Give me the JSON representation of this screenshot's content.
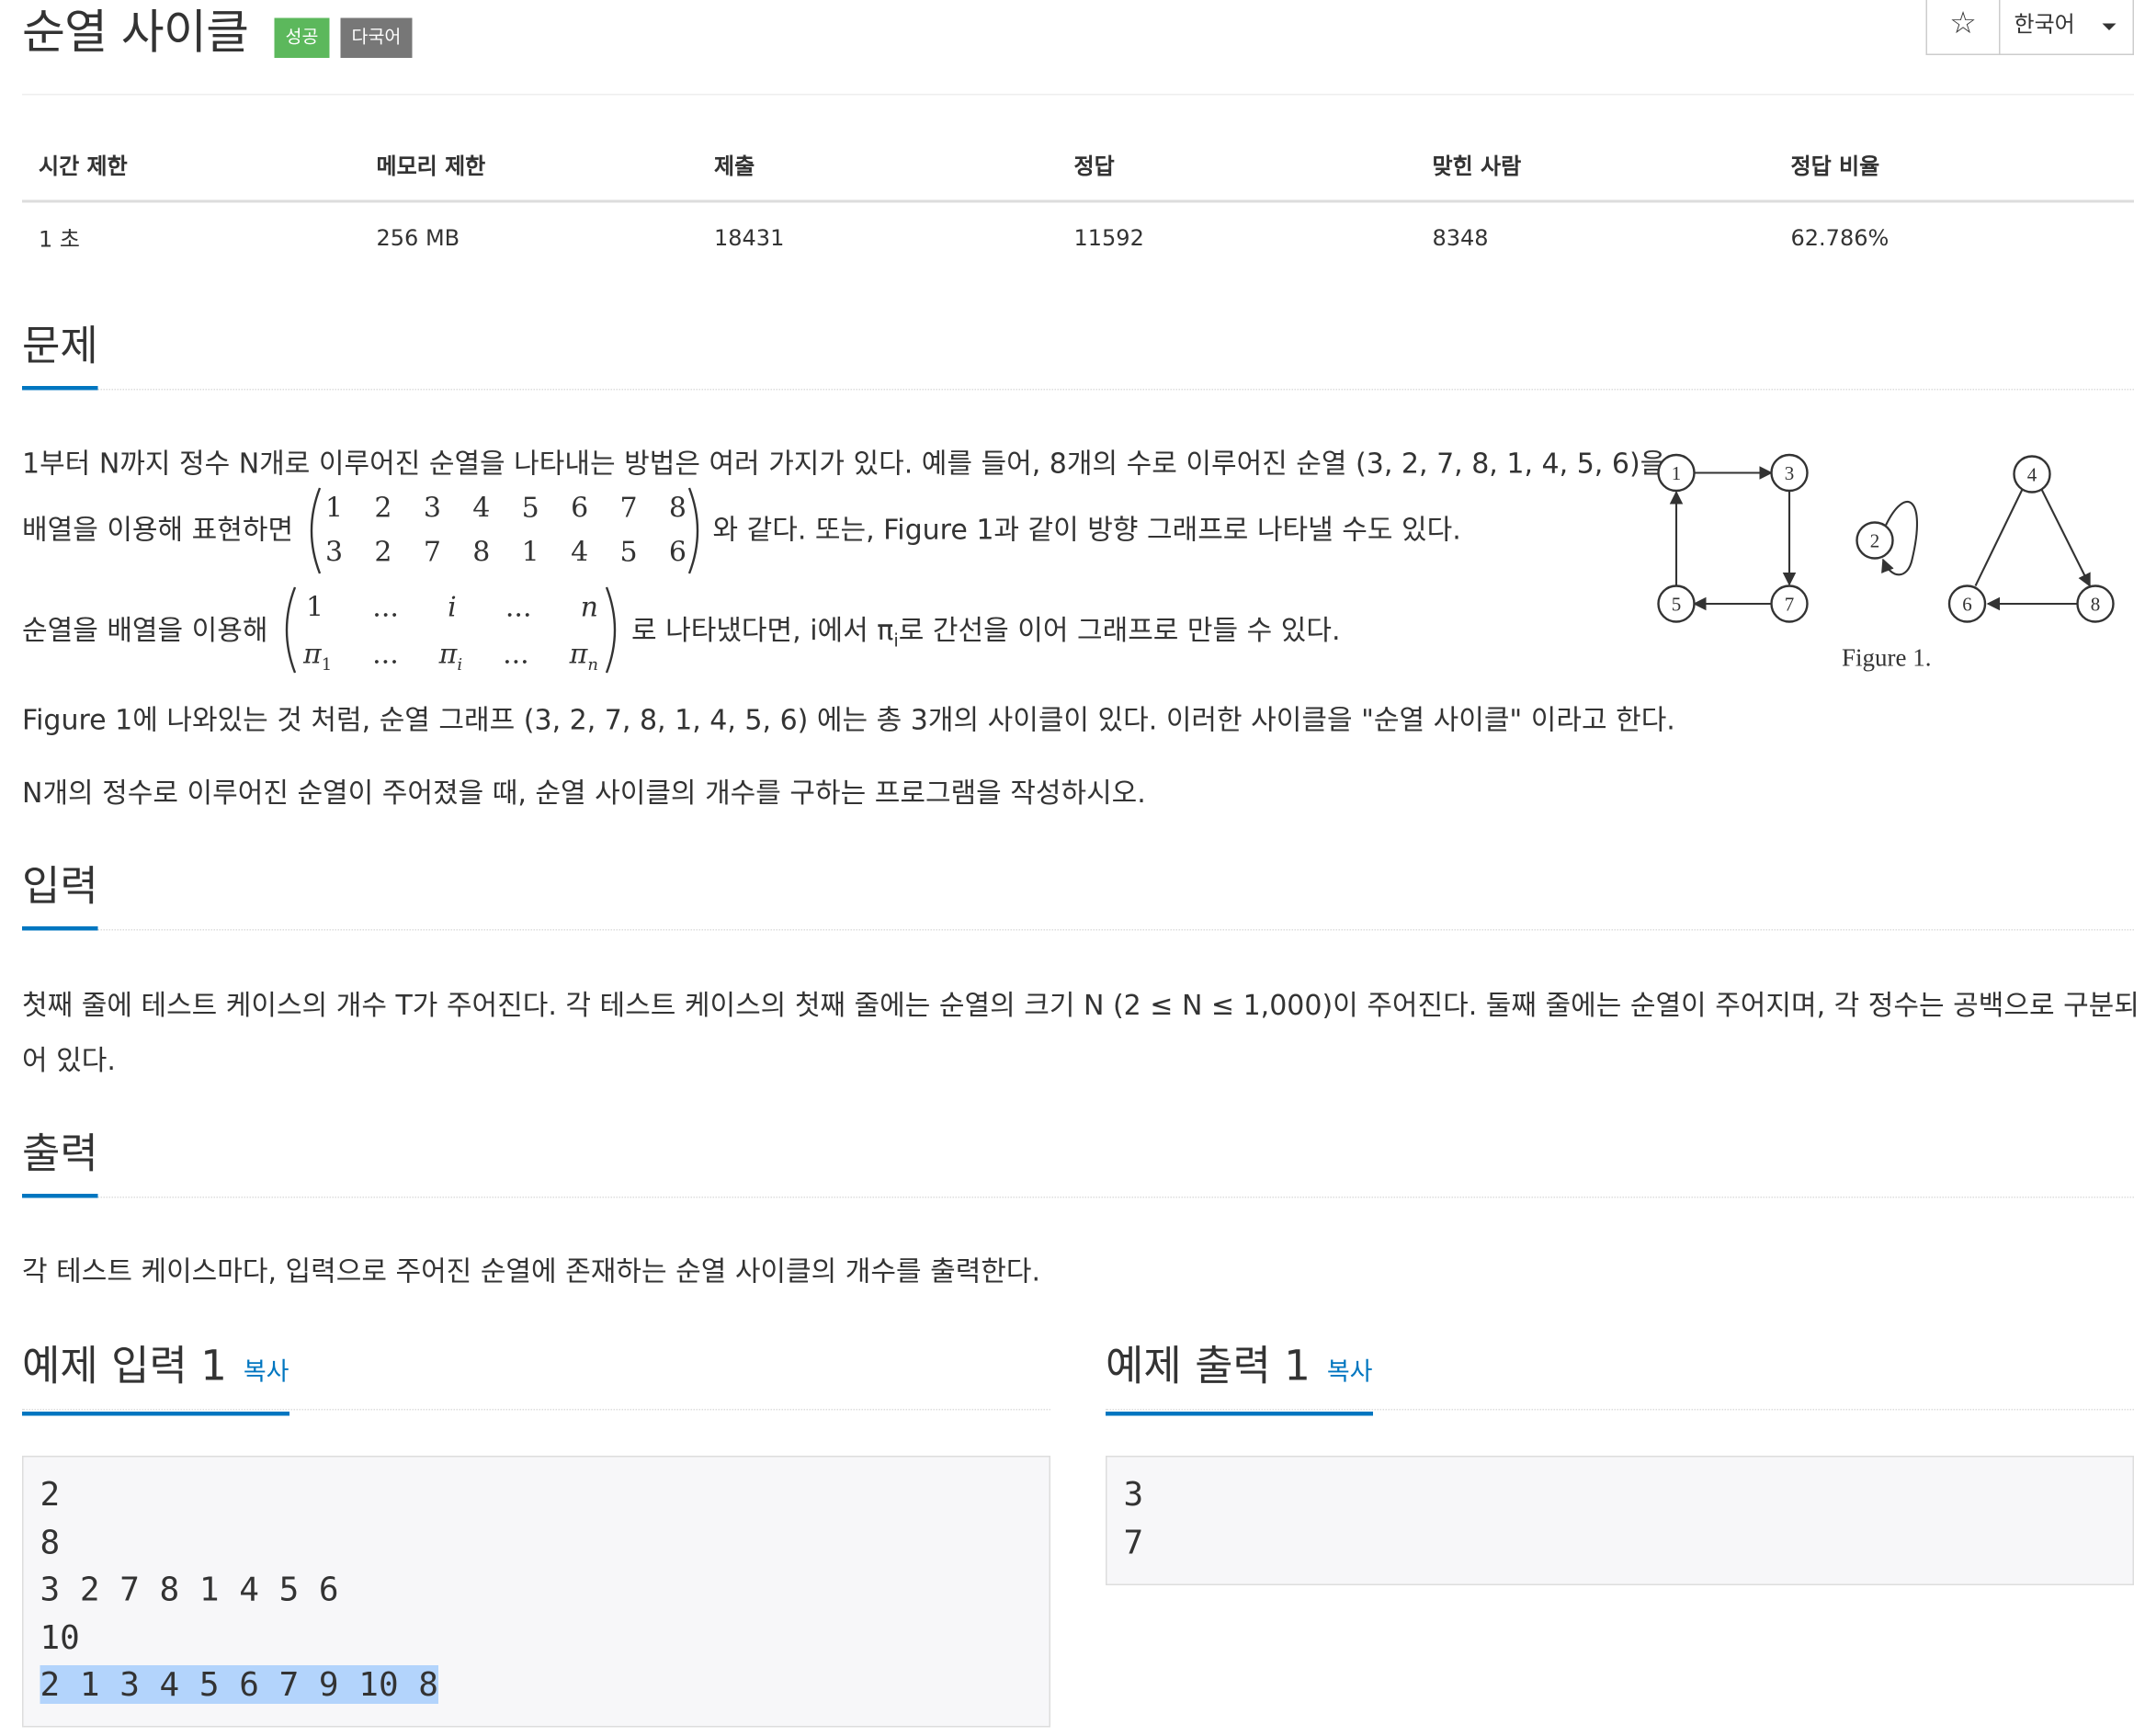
{
  "title": "순열 사이클",
  "badges": {
    "success": "성공",
    "multilang": "다국어"
  },
  "toolbar": {
    "star_icon": "star-icon",
    "star_glyph": "☆",
    "language": "한국어"
  },
  "info_table": {
    "headers": [
      "시간 제한",
      "메모리 제한",
      "제출",
      "정답",
      "맞힌 사람",
      "정답 비율"
    ],
    "values": [
      "1 초",
      "256 MB",
      "18431",
      "11592",
      "8348",
      "62.786%"
    ]
  },
  "problem": {
    "heading": "문제",
    "p1_a": "1부터 N까지 정수 N개로 이루어진 순열을 나타내는 방법은 여러 가지가 있다. 예를 들어, 8개의 수로 이루어진 순열 (3, 2, 7, 8, 1, 4, 5, 6)을",
    "p1_b_pre": "배열을 이용해 표현하면",
    "p1_b_post": "와 같다. 또는, Figure 1과 같이 방향 그래프로 나타낼 수도 있다.",
    "matrix1_row1": [
      "1",
      "2",
      "3",
      "4",
      "5",
      "6",
      "7",
      "8"
    ],
    "matrix1_row2": [
      "3",
      "2",
      "7",
      "8",
      "1",
      "4",
      "5",
      "6"
    ],
    "p2_pre": "순열을 배열을 이용해",
    "p2_post_a": "로 나타냈다면, i에서 π",
    "p2_post_sub": "i",
    "p2_post_b": "로 간선을 이어 그래프로 만들 수 있다.",
    "matrix2_row1": [
      "1",
      "...",
      "i",
      "...",
      "n"
    ],
    "matrix2_row2": [
      "π",
      "...",
      "π",
      "...",
      "π"
    ],
    "matrix2_row2_sub": [
      "1",
      "",
      "i",
      "",
      "n"
    ],
    "p3": "Figure 1에 나와있는 것 처럼, 순열 그래프 (3, 2, 7, 8, 1, 4, 5, 6) 에는 총 3개의 사이클이 있다. 이러한 사이클을 \"순열 사이클\" 이라고 한다.",
    "p4": "N개의 정수로 이루어진 순열이 주어졌을 때, 순열 사이클의 개수를 구하는 프로그램을 작성하시오.",
    "figure_nodes": [
      "1",
      "3",
      "5",
      "7",
      "2",
      "4",
      "6",
      "8"
    ],
    "figure_caption": "Figure 1."
  },
  "input": {
    "heading": "입력",
    "text_1": "첫째 줄에 테스트 케이스의 개수 T가 주어진다. 각 테스트 케이스의 첫째 줄에는 순열의 크기 N (2 ≤ N ≤ 1,000)이 주어진다. 둘째 줄에는 순열이 주어지며, 각 정수는 공백으로 구분되",
    "text_2": "어 있다."
  },
  "output": {
    "heading": "출력",
    "text": "각 테스트 케이스마다, 입력으로 주어진 순열에 존재하는 순열 사이클의 개수를 출력한다."
  },
  "sample_input": {
    "heading": "예제 입력 1",
    "copy": "복사",
    "lines": [
      "2",
      "8",
      "3 2 7 8 1 4 5 6",
      "10",
      "2 1 3 4 5 6 7 9 10 8"
    ]
  },
  "sample_output": {
    "heading": "예제 출력 1",
    "copy": "복사",
    "lines": [
      "3",
      "7"
    ]
  },
  "colors": {
    "accent": "#0076C0",
    "success": "#5cb85c",
    "multilang": "#777777",
    "selection": "#b3d4fc"
  }
}
